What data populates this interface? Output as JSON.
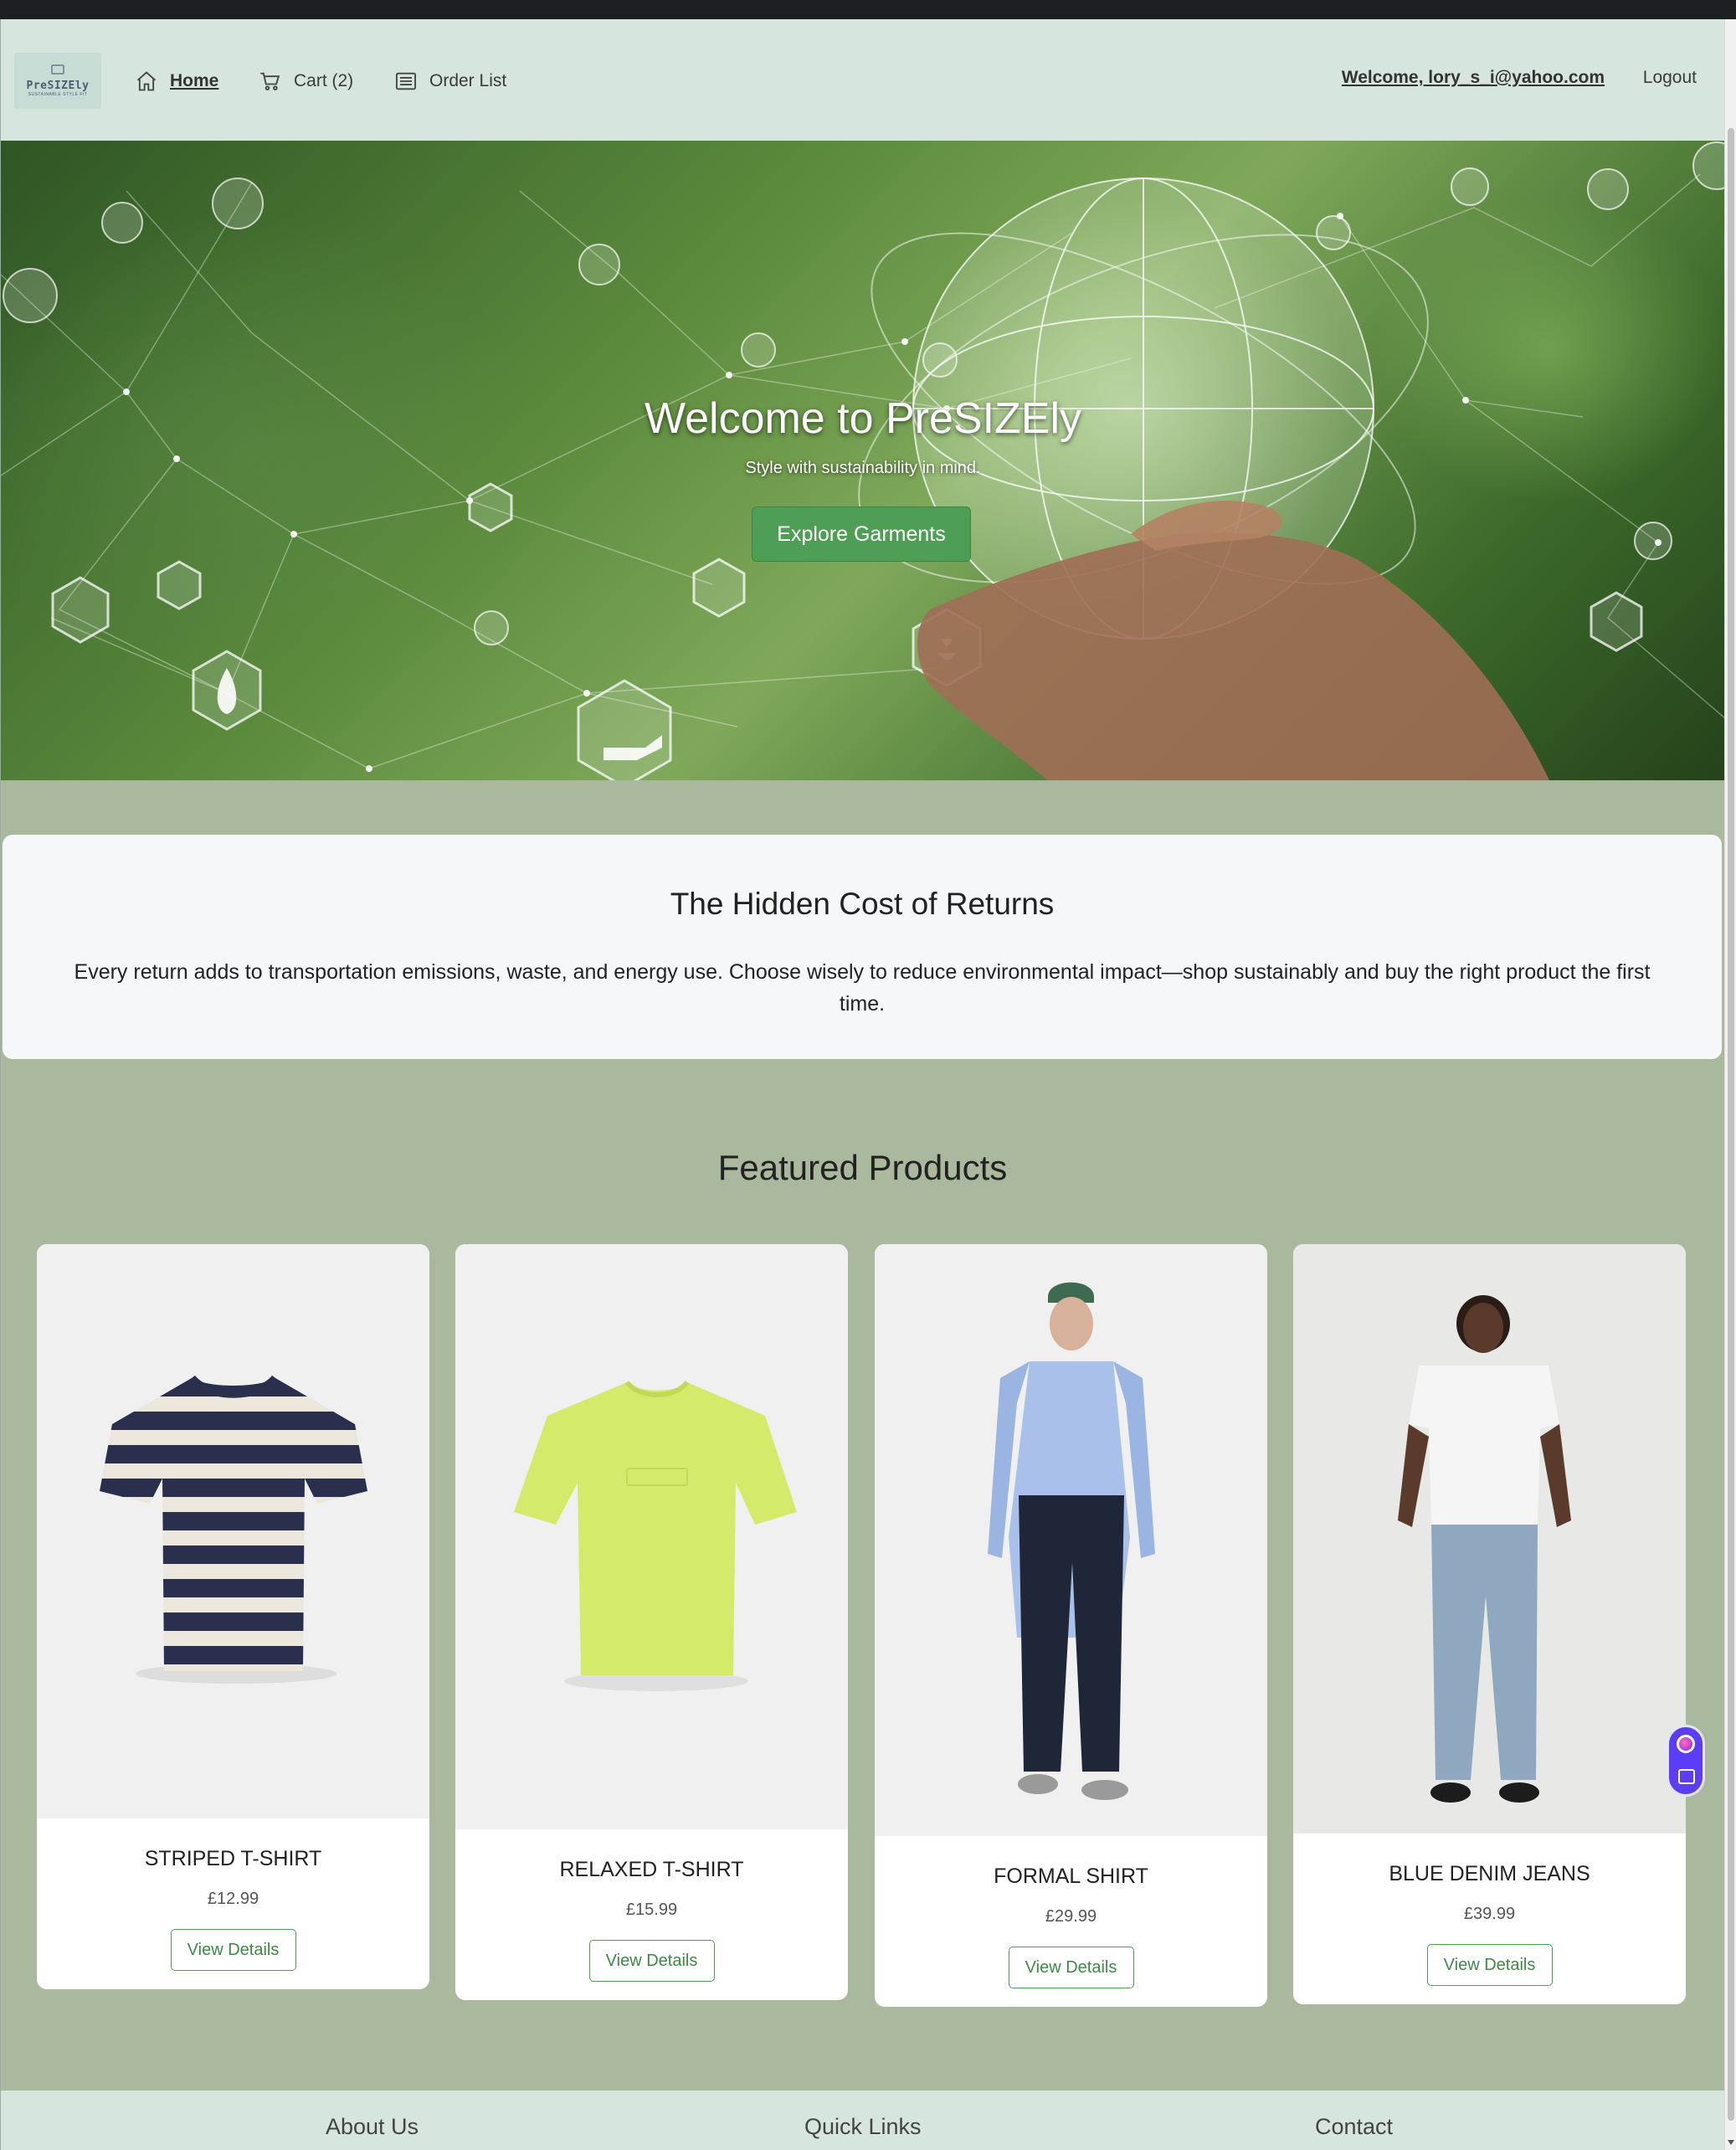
{
  "nav": {
    "logo_text": "PreSIZEly",
    "logo_tagline": "SUSTAINABLE STYLE FIT",
    "items": [
      {
        "label": "Home",
        "icon": "home-icon"
      },
      {
        "label": "Cart (2)",
        "icon": "cart-icon"
      },
      {
        "label": "Order List",
        "icon": "list-icon"
      }
    ],
    "welcome": "Welcome, lory_s_i@yahoo.com",
    "logout": "Logout"
  },
  "hero": {
    "title": "Welcome to PreSIZEly",
    "subtitle": "Style with sustainability in mind.",
    "button": "Explore Garments"
  },
  "info": {
    "title": "The Hidden Cost of Returns",
    "text": "Every return adds to transportation emissions, waste, and energy use. Choose wisely to reduce environmental impact—shop sustainably and buy the right product the first time."
  },
  "featured": {
    "title": "Featured Products",
    "products": [
      {
        "name": "STRIPED T-SHIRT",
        "price": "£12.99",
        "button": "View Details"
      },
      {
        "name": "RELAXED T-SHIRT",
        "price": "£15.99",
        "button": "View Details"
      },
      {
        "name": "FORMAL SHIRT",
        "price": "£29.99",
        "button": "View Details"
      },
      {
        "name": "BLUE DENIM JEANS",
        "price": "£39.99",
        "button": "View Details"
      }
    ]
  },
  "footer": {
    "columns": [
      "About Us",
      "Quick Links",
      "Contact"
    ]
  },
  "colors": {
    "nav_bg": "#d6e6df",
    "page_bg": "#aab99e",
    "accent_green": "#4e9f55"
  }
}
